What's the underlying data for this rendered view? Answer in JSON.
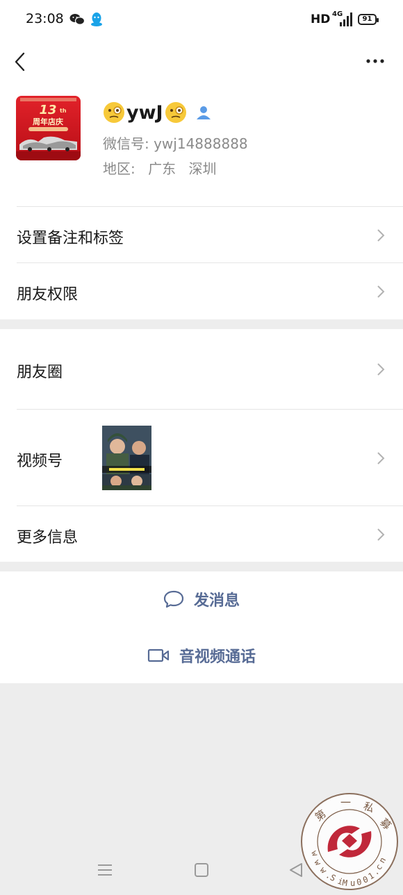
{
  "status_bar": {
    "time": "23:08",
    "hd": "HD",
    "network": "4G",
    "battery": "91"
  },
  "profile": {
    "name": "ywJ",
    "wechat_id": "微信号: ywj14888888",
    "region_label": "地区:",
    "region_province": "广东",
    "region_city": "深圳",
    "avatar_text": "13th 周年店庆"
  },
  "rows": {
    "remark_tags": "设置备注和标签",
    "friend_permissions": "朋友权限",
    "moments": "朋友圈",
    "channels": "视频号",
    "more_info": "更多信息"
  },
  "actions": {
    "send_message": "发消息",
    "video_call": "音视频通话"
  },
  "watermark": {
    "chars": "第一私募",
    "url": "www.SiMu001.cn"
  },
  "colors": {
    "link_blue": "#576b95",
    "background": "#ededed",
    "avatar_red": "#d6171f"
  }
}
